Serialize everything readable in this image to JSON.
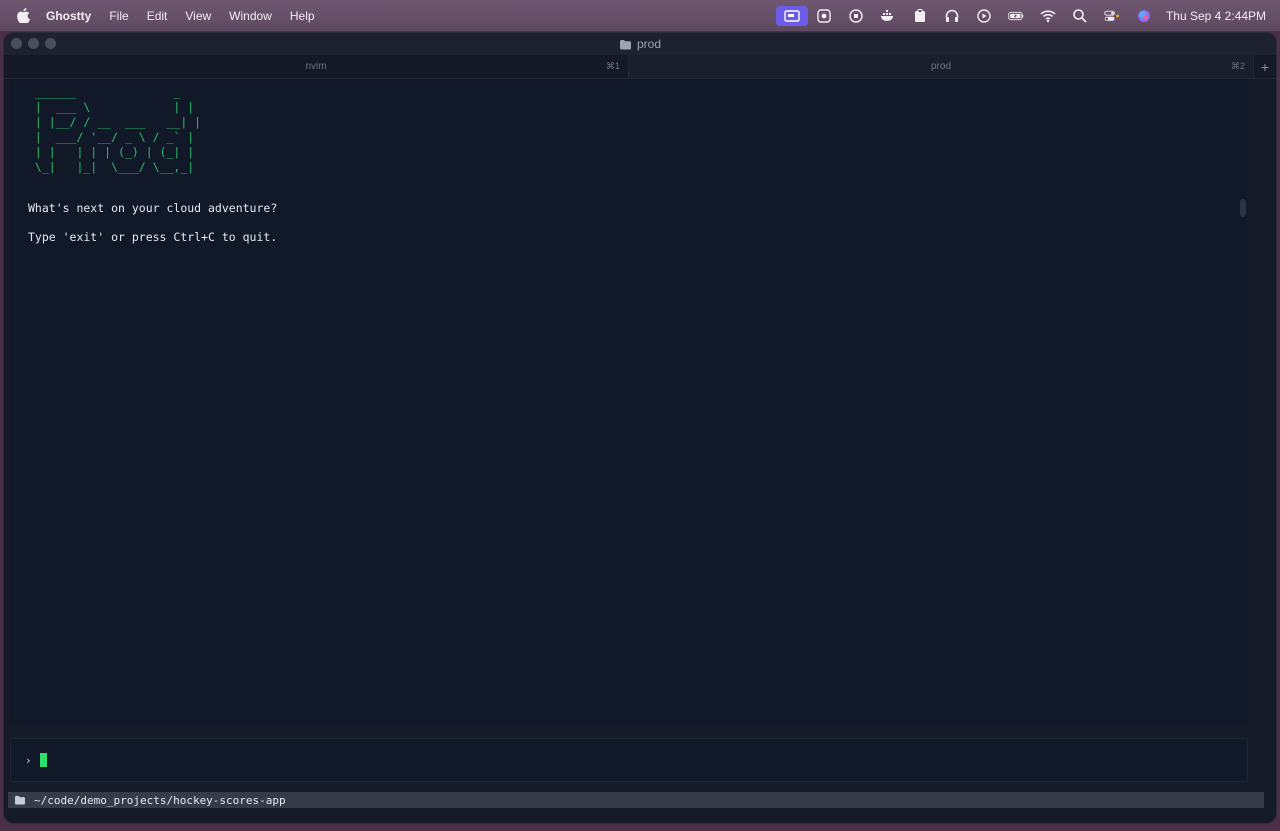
{
  "menubar": {
    "app_name": "Ghostty",
    "menus": [
      "File",
      "Edit",
      "View",
      "Window",
      "Help"
    ],
    "clock": "Thu Sep 4  2:44PM"
  },
  "window": {
    "title": "prod",
    "tabs": [
      {
        "label": "nvim",
        "shortcut": "⌘1"
      },
      {
        "label": "prod",
        "shortcut": "⌘2"
      }
    ],
    "add_tab_label": "+"
  },
  "terminal": {
    "ascii_art": " ______              _\n |  ___ \\            | |\n | |__/ / __  ___   __| |\n |  ___/ '__/ _ \\ / _` |\n | |   | | | (_) | (_| |\n \\_|   |_|  \\___/ \\__,_|",
    "line1": "What's next on your cloud adventure?",
    "line2": "Type 'exit' or press Ctrl+C to quit."
  },
  "input": {
    "prompt": "›"
  },
  "statusbar": {
    "path": "~/code/demo_projects/hockey-scores-app"
  },
  "colors": {
    "accent_green": "#2fbf6a",
    "cursor": "#2ee06b",
    "background": "#111827"
  }
}
